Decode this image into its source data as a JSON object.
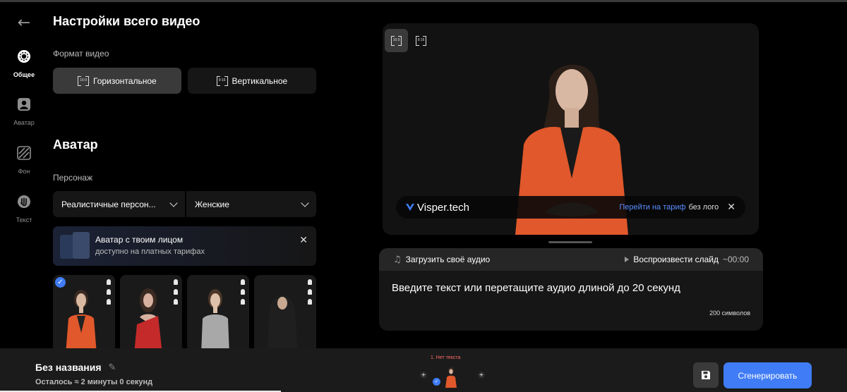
{
  "nav": {
    "items": [
      {
        "label": "Общее",
        "icon": "gear-icon",
        "active": true
      },
      {
        "label": "Аватар",
        "icon": "avatar-icon",
        "active": false
      },
      {
        "label": "Фон",
        "icon": "background-icon",
        "active": false
      },
      {
        "label": "Текст",
        "icon": "text-icon",
        "active": false
      }
    ]
  },
  "settings": {
    "title": "Настройки всего видео",
    "format_label": "Формат видео",
    "formats": [
      {
        "ratio": "16:9",
        "label": "Горизонтальное",
        "selected": true
      },
      {
        "ratio": "9:16",
        "label": "Вертикальное",
        "selected": false
      }
    ]
  },
  "avatar_section": {
    "title": "Аватар",
    "character_label": "Персонаж",
    "type_select": "Реалистичные персон...",
    "gender_select": "Женские",
    "promo_title": "Аватар с твоим лицом",
    "promo_subtitle": "доступно на платных тарифах",
    "avatars": [
      {
        "name": "orange-blazer",
        "selected": true,
        "color": "#e0582b"
      },
      {
        "name": "red-dress",
        "selected": false,
        "color": "#c42a2a"
      },
      {
        "name": "grey-top",
        "selected": false,
        "color": "#a8a8a8"
      },
      {
        "name": "black-hijab",
        "selected": false,
        "color": "#1f1f1f"
      }
    ]
  },
  "preview": {
    "ratio_buttons": [
      "16:9",
      "9:16"
    ],
    "brand": "Visper.tech",
    "upgrade_link": "Перейти на тариф",
    "upgrade_suffix": "без лого"
  },
  "audio": {
    "upload_label": "Загрузить своё аудио",
    "play_label": "Воспроизвести слайд",
    "duration": "~00:00",
    "placeholder": "Введите текст или перетащите аудио длиной до 20 секунд",
    "char_count": "200 символов"
  },
  "bottom": {
    "project_name": "Без названия",
    "remaining": "Осталось ≈ 2 минуты 0 секунд",
    "slide_label": "1. Нет текста",
    "generate_label": "Сгенерировать"
  },
  "colors": {
    "accent": "#3f7cf5",
    "link": "#5a8cff",
    "warning": "#ff6a6a"
  }
}
